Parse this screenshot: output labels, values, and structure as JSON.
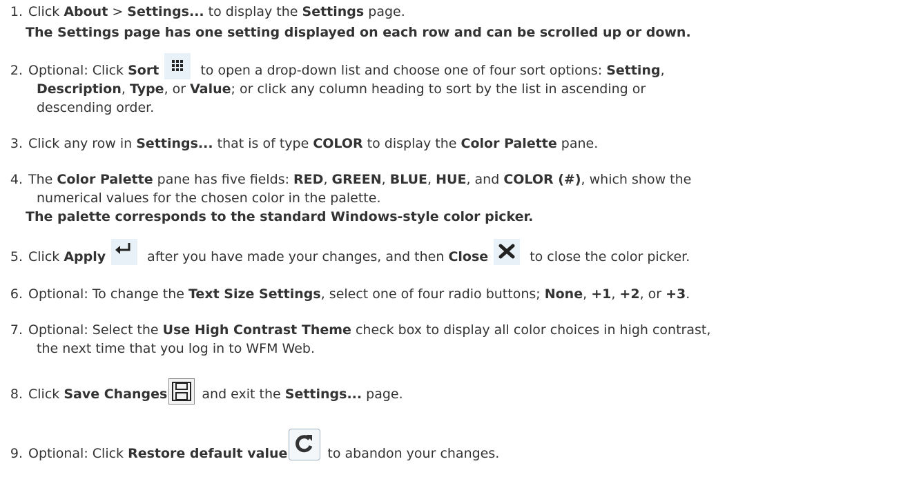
{
  "steps": [
    {
      "num": "1.",
      "parts": [
        {
          "t": "Click "
        },
        {
          "t": "About",
          "b": true
        },
        {
          "t": " > "
        },
        {
          "t": "Settings...",
          "b": true
        },
        {
          "t": " to display the "
        },
        {
          "t": "Settings",
          "b": true
        },
        {
          "t": " page."
        }
      ],
      "note": "The Settings page has one setting displayed on each row and can be scrolled up or down."
    },
    {
      "num": "2.",
      "parts": [
        {
          "t": "Optional: Click "
        },
        {
          "t": "Sort",
          "b": true
        },
        {
          "icon": "sort"
        },
        {
          "t": " to open a drop-down list and choose one of four sort options: "
        },
        {
          "t": "Setting",
          "b": true
        },
        {
          "t": ","
        }
      ],
      "cont": [
        [
          {
            "t": "Description",
            "b": true
          },
          {
            "t": ", "
          },
          {
            "t": "Type",
            "b": true
          },
          {
            "t": ", or "
          },
          {
            "t": "Value",
            "b": true
          },
          {
            "t": "; or click any column heading to sort by the list in ascending or"
          }
        ],
        [
          {
            "t": "descending order."
          }
        ]
      ]
    },
    {
      "num": "3.",
      "parts": [
        {
          "t": "Click any row in "
        },
        {
          "t": "Settings...",
          "b": true
        },
        {
          "t": " that is of type "
        },
        {
          "t": "COLOR",
          "b": true
        },
        {
          "t": " to display the "
        },
        {
          "t": "Color Palette",
          "b": true
        },
        {
          "t": " pane."
        }
      ]
    },
    {
      "num": "4.",
      "parts": [
        {
          "t": "The "
        },
        {
          "t": "Color Palette",
          "b": true
        },
        {
          "t": " pane has five fields: "
        },
        {
          "t": "RED",
          "b": true
        },
        {
          "t": ", "
        },
        {
          "t": "GREEN",
          "b": true
        },
        {
          "t": ", "
        },
        {
          "t": "BLUE",
          "b": true
        },
        {
          "t": ", "
        },
        {
          "t": "HUE",
          "b": true
        },
        {
          "t": ", and "
        },
        {
          "t": "COLOR (#)",
          "b": true
        },
        {
          "t": ", which show the"
        }
      ],
      "cont": [
        [
          {
            "t": "numerical values for the chosen color in the palette."
          }
        ]
      ],
      "note": "The palette corresponds to the standard Windows-style color picker."
    },
    {
      "num": "5.",
      "parts": [
        {
          "t": "Click "
        },
        {
          "t": "Apply",
          "b": true
        },
        {
          "icon": "apply"
        },
        {
          "t": " after you have made your changes, and then "
        },
        {
          "t": "Close",
          "b": true
        },
        {
          "icon": "close"
        },
        {
          "t": " to close the color picker."
        }
      ]
    },
    {
      "num": "6.",
      "parts": [
        {
          "t": "Optional: To change the "
        },
        {
          "t": "Text Size Settings",
          "b": true
        },
        {
          "t": ", select one of four radio buttons; "
        },
        {
          "t": "None",
          "b": true
        },
        {
          "t": ", "
        },
        {
          "t": "+1",
          "b": true
        },
        {
          "t": ", "
        },
        {
          "t": "+2",
          "b": true
        },
        {
          "t": ", or "
        },
        {
          "t": "+3",
          "b": true
        },
        {
          "t": "."
        }
      ]
    },
    {
      "num": "7.",
      "parts": [
        {
          "t": "Optional: Select the "
        },
        {
          "t": "Use High Contrast Theme",
          "b": true
        },
        {
          "t": " check box to display all color choices in high contrast,"
        }
      ],
      "cont": [
        [
          {
            "t": "the next time that you log in to WFM Web."
          }
        ]
      ]
    },
    {
      "num": "8.",
      "parts": [
        {
          "t": "Click "
        },
        {
          "t": "Save Changes",
          "b": true
        },
        {
          "icon": "save"
        },
        {
          "t": " and exit the "
        },
        {
          "t": "Settings...",
          "b": true
        },
        {
          "t": " page."
        }
      ]
    },
    {
      "num": "9.",
      "parts": [
        {
          "t": "Optional: Click "
        },
        {
          "t": "Restore default value",
          "b": true
        },
        {
          "icon": "restore"
        },
        {
          "t": " to abandon your changes."
        }
      ]
    }
  ]
}
